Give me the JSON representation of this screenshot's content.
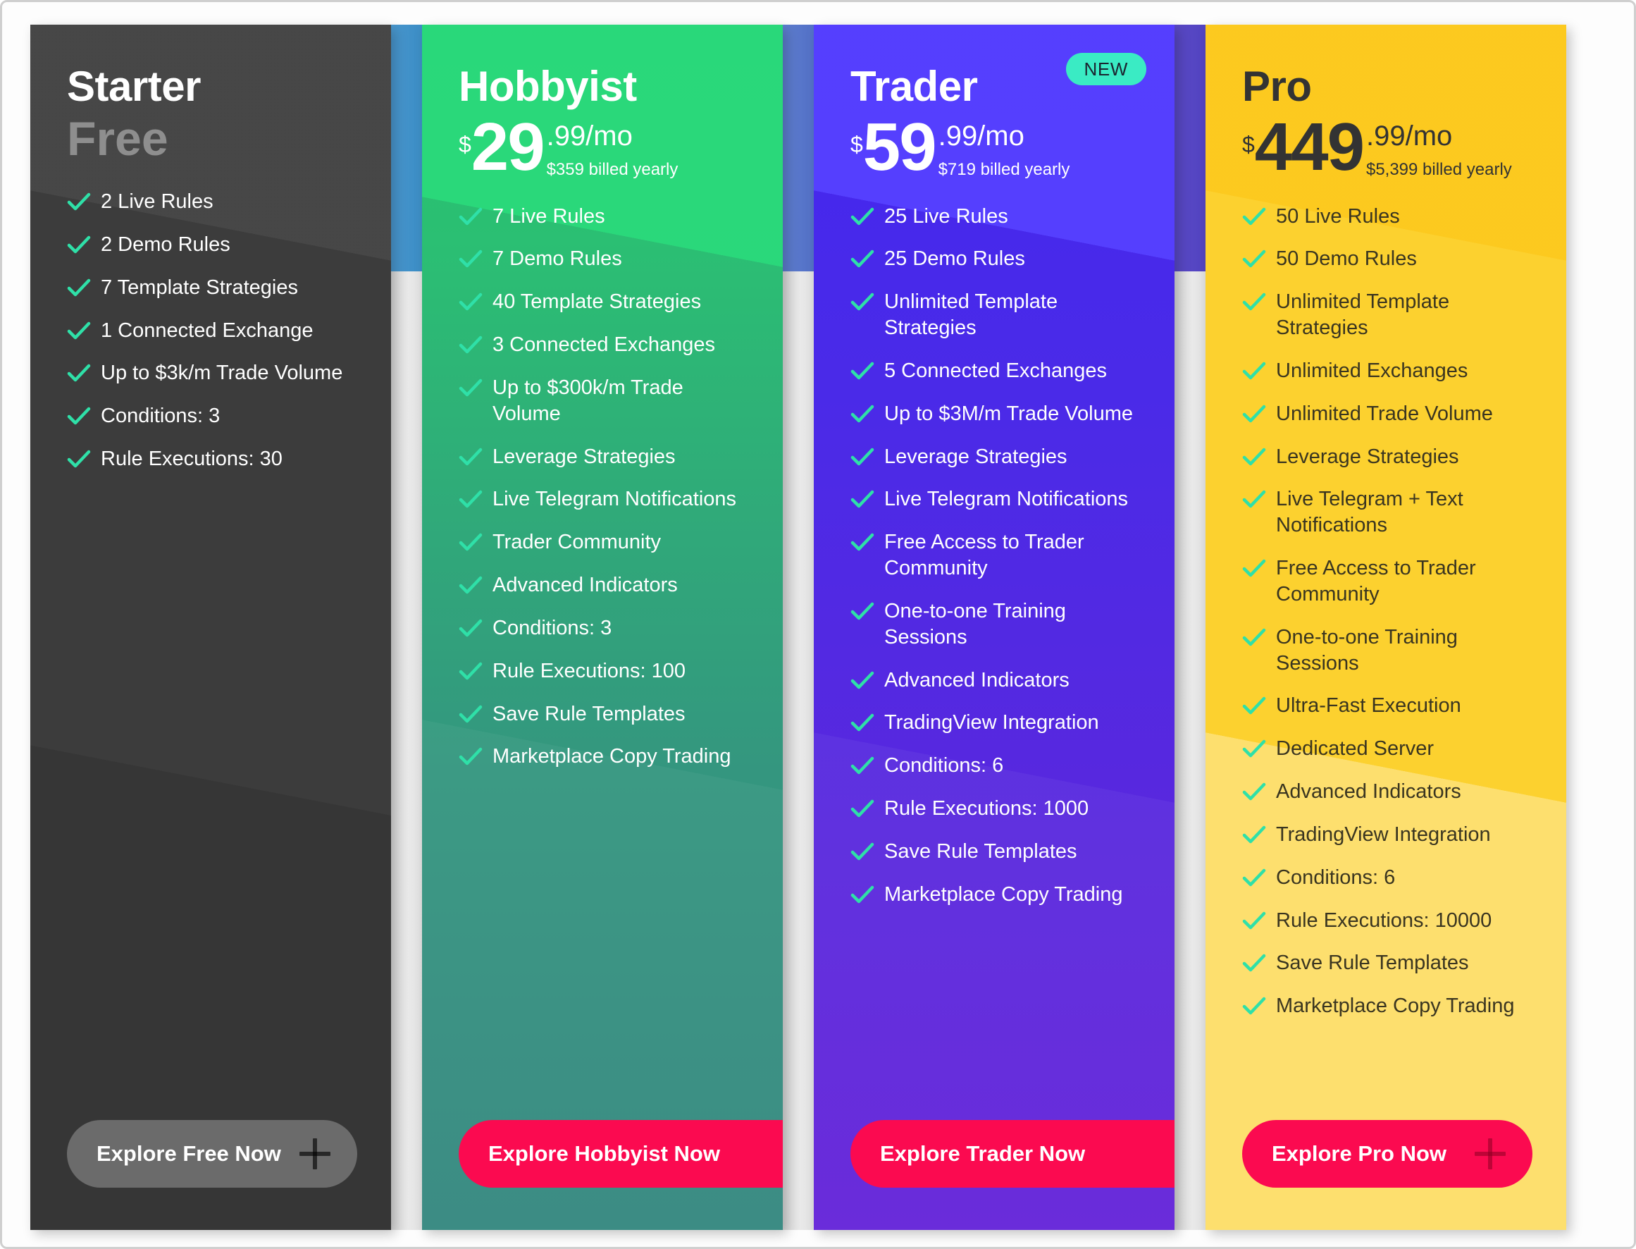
{
  "plans": [
    {
      "id": "starter",
      "name": "Starter",
      "price_free_label": "Free",
      "currency": "",
      "amount": "",
      "cents": "",
      "billed": "",
      "badge": "",
      "accent_color": "#3c3c3c",
      "cta_label": "Explore Free Now",
      "cta_icon": "plus-icon",
      "features": [
        "2 Live Rules",
        "2 Demo Rules",
        "7 Template Strategies",
        "1 Connected Exchange",
        "Up to $3k/m Trade Volume",
        "Conditions: 3",
        "Rule Executions: 30"
      ]
    },
    {
      "id": "hobbyist",
      "name": "Hobbyist",
      "price_free_label": "",
      "currency": "$",
      "amount": "29",
      "cents": ".99/mo",
      "billed": "$359 billed yearly",
      "badge": "",
      "accent_color": "#24c16b",
      "cta_label": "Explore Hobbyist Now",
      "cta_icon": "plus-icon",
      "features": [
        "7 Live Rules",
        "7 Demo Rules",
        "40 Template Strategies",
        "3 Connected Exchanges",
        "Up to $300k/m Trade Volume",
        "Leverage Strategies",
        "Live Telegram Notifications",
        "Trader Community",
        "Advanced Indicators",
        "Conditions: 3",
        "Rule Executions: 100",
        "Save Rule Templates",
        "Marketplace Copy Trading"
      ]
    },
    {
      "id": "trader",
      "name": "Trader",
      "price_free_label": "",
      "currency": "$",
      "amount": "59",
      "cents": ".99/mo",
      "billed": "$719 billed yearly",
      "badge": "NEW",
      "accent_color": "#4327ef",
      "cta_label": "Explore Trader Now",
      "cta_icon": "plus-icon",
      "features": [
        "25 Live Rules",
        "25 Demo Rules",
        "Unlimited Template Strategies",
        "5 Connected Exchanges",
        "Up to $3M/m Trade Volume",
        "Leverage Strategies",
        "Live Telegram Notifications",
        "Free Access to Trader Community",
        "One-to-one Training Sessions",
        "Advanced Indicators",
        "TradingView Integration",
        "Conditions: 6",
        "Rule Executions: 1000",
        "Save Rule Templates",
        "Marketplace Copy Trading"
      ]
    },
    {
      "id": "pro",
      "name": "Pro",
      "price_free_label": "",
      "currency": "$",
      "amount": "449",
      "cents": ".99/mo",
      "billed": "$5,399 billed yearly",
      "badge": "",
      "accent_color": "#fcd12f",
      "cta_label": "Explore Pro Now",
      "cta_icon": "plus-icon",
      "features": [
        "50 Live Rules",
        "50 Demo Rules",
        "Unlimited Template Strategies",
        "Unlimited Exchanges",
        "Unlimited Trade Volume",
        "Leverage Strategies",
        "Live Telegram + Text Notifications",
        "Free Access to Trader Community",
        "One-to-one Training Sessions",
        "Ultra-Fast Execution",
        "Dedicated Server",
        "Advanced Indicators",
        "TradingView Integration",
        "Conditions: 6",
        "Rule Executions: 10000",
        "Save Rule Templates",
        "Marketplace Copy Trading"
      ]
    }
  ],
  "theme": {
    "check_color": "#2fe0a8",
    "cta_pink": "#fb0a50",
    "cta_grey": "#6b6b6b",
    "badge_bg": "#3aebc4"
  }
}
